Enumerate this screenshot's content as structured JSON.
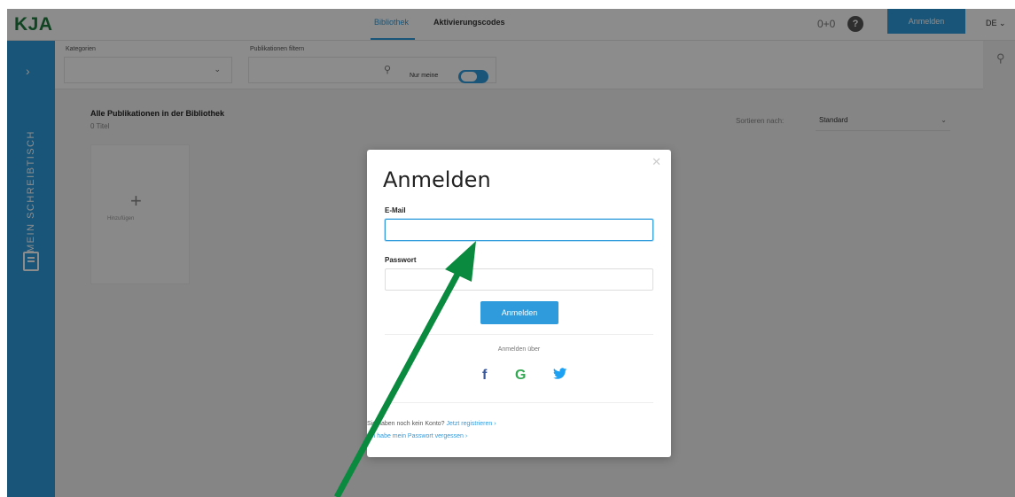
{
  "app": {
    "logo": "KJA"
  },
  "topbar": {
    "tabs": [
      {
        "label": "Bibliothek",
        "active": true
      },
      {
        "label": "Aktivierungscodes",
        "active": false
      }
    ],
    "badge_label": "0+0",
    "help_icon": "help-icon",
    "primary_button": "Anmelden",
    "language": "DE ⌄"
  },
  "sidebar": {
    "label": "MEIN SCHREIBTISCH",
    "chevron": "›"
  },
  "filters": {
    "categories_label": "Kategorien",
    "search_label": "Publikationen filtern",
    "only_mine_label": "Nur meine"
  },
  "library": {
    "title": "Alle Publikationen in der Bibliothek",
    "count": "0 Titel",
    "sort_label": "Sortieren nach:",
    "sort_value": "Standard",
    "add_tile_label": "Hinzufügen"
  },
  "modal": {
    "title": "Anmelden",
    "email_label": "E-Mail",
    "email_value": "",
    "password_label": "Passwort",
    "password_value": "",
    "login_button": "Anmelden",
    "login_via": "Anmelden über",
    "social": [
      {
        "name": "facebook-icon",
        "glyph": "f",
        "color": "#3b5998"
      },
      {
        "name": "google-icon",
        "glyph": "G",
        "color": "#34a853"
      },
      {
        "name": "twitter-icon",
        "glyph": "🐦",
        "color": "#1da1f2"
      }
    ],
    "no_account_text": "Sie haben noch kein Konto?",
    "register_link": "Jetzt registrieren ›",
    "forgot_password_link": "Ich habe mein Passwort vergessen ›"
  },
  "colors": {
    "accent": "#2f9bdc",
    "logo_green": "#1c7a3c",
    "annotation_arrow": "#0a8a3e"
  }
}
